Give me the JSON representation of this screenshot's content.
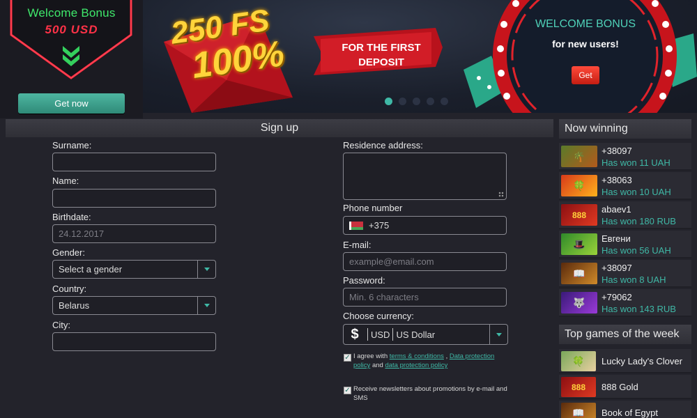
{
  "welcome": {
    "title": "Welcome Bonus",
    "amount": "500 USD",
    "button": "Get now"
  },
  "banner": {
    "fs_text": "250 FS",
    "percent_text": "100%",
    "ribbon_line1": "FOR THE FIRST",
    "ribbon_line2": "DEPOSIT",
    "circle_title": "WELCOME BONUS",
    "circle_sub": "for new users!",
    "get_button": "Get",
    "slides": 5,
    "active_slide": 1
  },
  "signup": {
    "title": "Sign up",
    "surname": {
      "label": "Surname:",
      "value": ""
    },
    "name": {
      "label": "Name:",
      "value": ""
    },
    "birthdate": {
      "label": "Birthdate:",
      "placeholder": "24.12.2017"
    },
    "gender": {
      "label": "Gender:",
      "selected": "Select a gender"
    },
    "country": {
      "label": "Country:",
      "selected": "Belarus"
    },
    "city": {
      "label": "City:",
      "value": ""
    },
    "address": {
      "label": "Residence address:",
      "value": ""
    },
    "phone": {
      "label": "Phone number",
      "value": "+375"
    },
    "email": {
      "label": "E-mail:",
      "placeholder": "example@email.com"
    },
    "password": {
      "label": "Password:",
      "placeholder": "Min. 6 characters"
    },
    "currency": {
      "label": "Choose currency:",
      "symbol": "$",
      "code": "USD",
      "name": "US Dollar"
    },
    "agree": {
      "checked": true,
      "prefix": "I agree with",
      "terms_link": "terms & conditions",
      "sep": ",",
      "data_link_1": "Data protection",
      "data_link_2": "policy",
      "and": "and",
      "protection_link": "data protection policy"
    },
    "newsletter": {
      "checked": true,
      "line1": "Receive newsletters about promotions by e-mail and",
      "line2": "SMS"
    }
  },
  "now_winning": {
    "title": "Now winning",
    "items": [
      {
        "name": "+38097",
        "amount": "Has won 11 UAH",
        "thumb": "jungle-slot"
      },
      {
        "name": "+38063",
        "amount": "Has won 10 UAH",
        "thumb": "lucky-slot"
      },
      {
        "name": "abaev1",
        "amount": "Has won 180 RUB",
        "thumb": "888-slot"
      },
      {
        "name": "Евгени",
        "amount": "Has won 56 UAH",
        "thumb": "green-slot"
      },
      {
        "name": "+38097",
        "amount": "Has won 8 UAH",
        "thumb": "egypt-slot"
      },
      {
        "name": "+79062",
        "amount": "Has won 143 RUB",
        "thumb": "wolf-gold-slot"
      }
    ]
  },
  "top_games": {
    "title": "Top games of the week",
    "items": [
      {
        "name": "Lucky Lady's Clover"
      },
      {
        "name": "888 Gold"
      },
      {
        "name": "Book of Egypt"
      }
    ]
  },
  "colors": {
    "accent": "#3fb8a6",
    "neon_green": "#3fe86b",
    "neon_red": "#ff3247",
    "background": "#23232b"
  }
}
